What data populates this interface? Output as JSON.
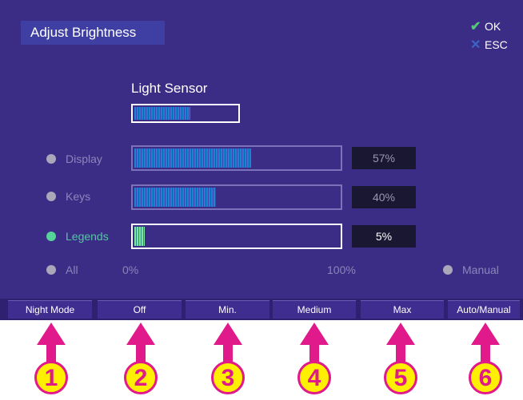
{
  "dialog": {
    "title": "Adjust Brightness",
    "ok_label": "OK",
    "esc_label": "ESC"
  },
  "light_sensor": {
    "label": "Light Sensor",
    "level": 0.55
  },
  "rows": [
    {
      "label": "Display",
      "value": "57%",
      "level": 0.57,
      "active": false
    },
    {
      "label": "Keys",
      "value": "40%",
      "level": 0.4,
      "active": false
    },
    {
      "label": "Legends",
      "value": "5%",
      "level": 0.05,
      "active": true
    }
  ],
  "all_label": "All",
  "scale": {
    "min": "0%",
    "max": "100%"
  },
  "manual_label": "Manual",
  "softkeys": [
    "Night Mode",
    "Off",
    "Min.",
    "Medium",
    "Max",
    "Auto/Manual"
  ],
  "callouts": [
    "1",
    "2",
    "3",
    "4",
    "5",
    "6"
  ],
  "colors": {
    "screen_bg": "#3b2d86",
    "active_green": "#56d39a",
    "callout_pink": "#e01a8a",
    "callout_yellow": "#ffef00"
  }
}
